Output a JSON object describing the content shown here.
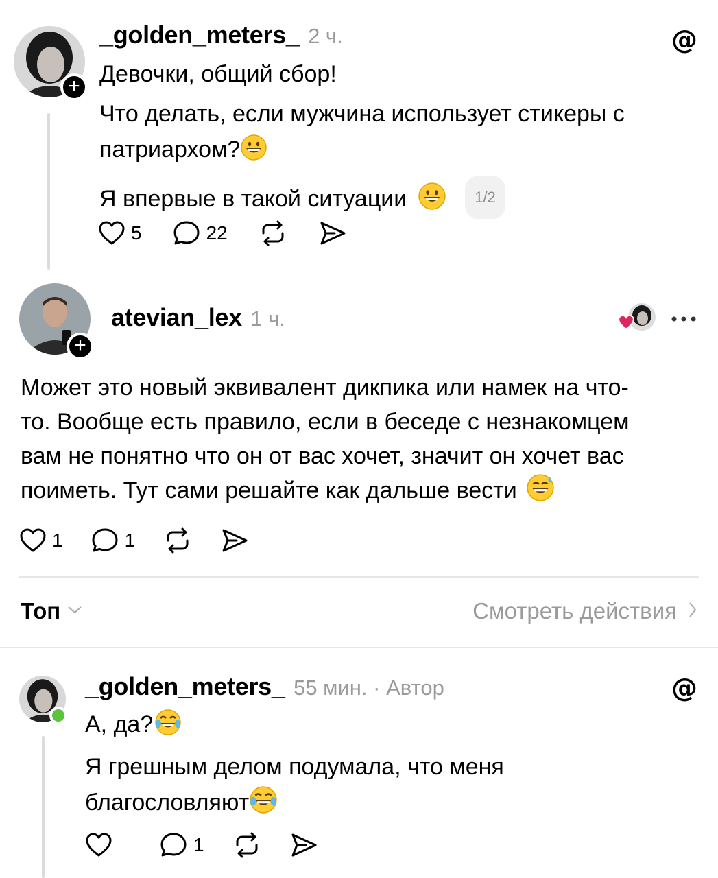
{
  "post1": {
    "username": "_golden_meters_",
    "time": "2 ч.",
    "lines": [
      "Девочки, общий сбор!",
      "Что делать, если мужчина использует стикеры с",
      "патриархом?",
      "Я впервые в такой ситуации"
    ],
    "page_indicator": "1/2",
    "likes": "5",
    "replies": "22",
    "icons": [
      "threads-icon",
      "heart-icon",
      "reply-icon",
      "repost-icon",
      "share-icon",
      "grinning-emoji"
    ]
  },
  "post2": {
    "username": "atevian_lex",
    "time": "1 ч.",
    "lines": [
      "Может это новый эквивалент дикпика или намек на что-",
      "то. Вообще есть правило, если в беседе с незнакомцем",
      "вам не понятно что он от вас хочет,  значит он хочет вас",
      "поиметь. Тут сами решайте как дальше вести"
    ],
    "likes": "1",
    "replies": "1",
    "icons": [
      "liked-by-author-icon",
      "more-icon",
      "sweat-smile-emoji"
    ]
  },
  "sort_bar": {
    "sort_label": "Топ",
    "activity_link": "Смотреть действия",
    "icons": [
      "chevron-down-icon",
      "chevron-right-icon"
    ]
  },
  "reply1": {
    "username": "_golden_meters_",
    "meta": "55 мин. · Автор",
    "lines": [
      "А, да?",
      "Я грешным делом подумала, что меня",
      "благословляют"
    ],
    "likes": "",
    "replies": "1",
    "icons": [
      "threads-icon",
      "tears-of-joy-emoji"
    ]
  },
  "colors": {
    "muted": "#9a9a9a",
    "online": "#5ac43d",
    "like_red": "#e0245e",
    "divider": "#e6e6e6"
  }
}
